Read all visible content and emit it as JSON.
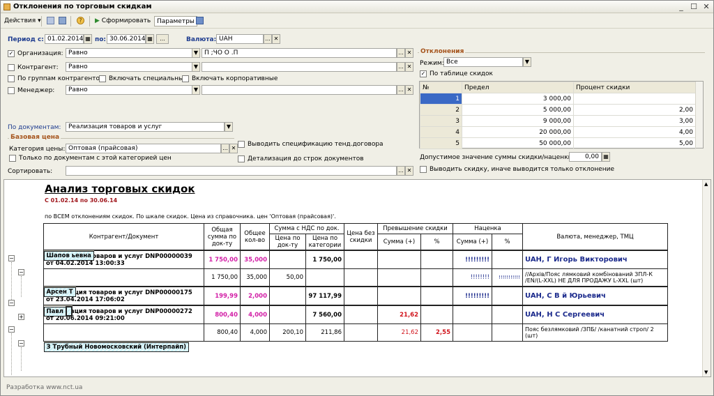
{
  "window": {
    "title": "Отклонения по торговым скидкам"
  },
  "toolbar": {
    "actions": "Действия",
    "generate": "Сформировать",
    "params": "Параметры"
  },
  "period": {
    "label_from": "Период с:",
    "from": "01.02.2014",
    "label_to": "по:",
    "to": "30.06.2014",
    "more": "..."
  },
  "currency": {
    "label": "Валюта:",
    "value": "UAH"
  },
  "filters": {
    "org_label": "Организация:",
    "org_mode": "Равно",
    "org_value": "П   ;ЧО О    .П",
    "contr_label": "Контрагент:",
    "contr_mode": "Равно",
    "by_groups": "По группам контрагентов",
    "incl_special": "Включать специальные",
    "incl_corp": "Включать корпоративные",
    "mgr_label": "Менеджер:",
    "mgr_mode": "Равно"
  },
  "docs": {
    "label": "По документам:",
    "value": "Реализация товаров и услуг"
  },
  "base_price": {
    "group": "Базовая цена",
    "cat_label": "Категория цены:",
    "cat_value": "Оптовая (прайсовая)",
    "only_docs": "Только по документам с этой категорией цен",
    "show_spec": "Выводить спецификацию тенд.договора",
    "detail": "Детализация до строк документов"
  },
  "sort": {
    "label": "Сортировать:"
  },
  "deviations": {
    "group": "Отклонения",
    "mode_label": "Режим:",
    "mode_value": "Все",
    "by_table": "По таблице скидок",
    "headers": [
      "№",
      "Предел",
      "Процент скидки"
    ],
    "rows": [
      {
        "n": "1",
        "limit": "3 000,00",
        "pct": ""
      },
      {
        "n": "2",
        "limit": "5 000,00",
        "pct": "2,00"
      },
      {
        "n": "3",
        "limit": "9 000,00",
        "pct": "3,00"
      },
      {
        "n": "4",
        "limit": "20 000,00",
        "pct": "4,00"
      },
      {
        "n": "5",
        "limit": "50 000,00",
        "pct": "5,00"
      }
    ],
    "allowed_label": "Допустимое значение суммы скидки/наценки:",
    "allowed_value": "0,00",
    "show_discount": "Выводить скидку, иначе выводится только отклонение"
  },
  "report": {
    "title": "Анализ торговых скидок",
    "period": "С 01.02.14 по 30.06.14",
    "desc": "по ВСЕМ отклонениям скидок. По шкале скидок. Цена из справочника. цен 'Оптовая (прайсовая)'.",
    "h": {
      "contr": "Контрагент/Документ",
      "total": "Общая сумма по док-ту",
      "qty": "Общее кол-во",
      "vat": "Сумма с НДС по док.",
      "vat_doc": "Цена по док-ту",
      "vat_cat": "Цена по категории",
      "nodisc": "Цена без скидки",
      "exceed": "Превышение скидки",
      "sum": "Сумма (+)",
      "pct": "%",
      "markup": "Наценка",
      "msum": "Сумма (+)",
      "mpct": "%",
      "cur": "Валюта, менеджер, ТМЦ"
    },
    "g1": "Шапов                                   ьевна",
    "d1": {
      "doc": "Реализация товаров и услуг DNP00000039 от 04.02.2014 13:00:33",
      "total": "1 750,00",
      "qty": "35,000",
      "cat": "1 750,00",
      "msum": "!!!!!!!!!",
      "cur": "UAH, Г          Игорь  Викторович"
    },
    "r1": {
      "total": "1 750,00",
      "qty": "35,000",
      "doc": "50,00",
      "msum": "!!!!!!!!",
      "mpct": "!!!!!!!!!!!",
      "cur": "//Архів/Пояс лямковий комбінований ЗПЛ-К /EN/(L-XXL) НЕ ДЛЯ ПРОДАЖУ L-XXL (шт)"
    },
    "g2": "Арсен                     Т",
    "d2": {
      "doc": "Реализация товаров и услуг DNP00000175 от 23.04.2014 17:06:02",
      "total": "199,99",
      "qty": "2,000",
      "cat": "97 117,99",
      "msum": "!!!!!!!!!",
      "cur": "UAH, С            В       й Юрьевич"
    },
    "g3": "Павл",
    "d3": {
      "doc": "Реализация товаров и услуг DNP00000272 от 20.06.2014 09:21:00",
      "total": "800,40",
      "qty": "4,000",
      "cat": "7 560,00",
      "esum": "21,62",
      "cur": "UAH, Н               С        Сергеевич"
    },
    "r3": {
      "total": "800,40",
      "qty": "4,000",
      "doc": "200,10",
      "cat": "211,86",
      "esum": "21,62",
      "epct": "2,55",
      "cur": "Пояс безлямковий /ЗПБ/ /канатний строп/ 2 (шт)"
    },
    "g4": "З   Трубный  Новомосковский (Интерпайп)"
  },
  "footer": "Разработка www.nct.ua"
}
